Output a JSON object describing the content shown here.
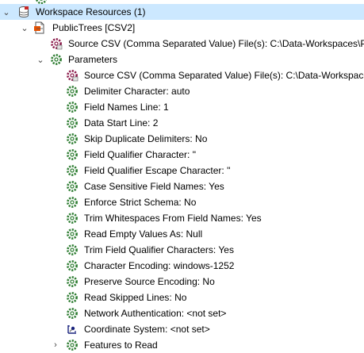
{
  "tree": {
    "root": {
      "label": "Workspace Resources (1)",
      "icon": "database-icon"
    },
    "reader": {
      "label": "PublicTrees [CSV2]",
      "icon": "csv-file-icon"
    },
    "source_dataset": {
      "label": "Source CSV (Comma Separated Value) File(s): C:\\Data-Workspaces\\P...",
      "icon": "dataset-gear-icon"
    },
    "parameters": {
      "label": "Parameters",
      "icon": "gear-icon"
    },
    "params": [
      {
        "label": "Source CSV (Comma Separated Value) File(s): C:\\Data-Workspace...",
        "icon": "dataset-gear-icon"
      },
      {
        "label": "Delimiter Character: auto",
        "icon": "gear-icon"
      },
      {
        "label": "Field Names Line: 1",
        "icon": "gear-icon"
      },
      {
        "label": "Data Start Line: 2",
        "icon": "gear-icon"
      },
      {
        "label": "Skip Duplicate Delimiters: No",
        "icon": "gear-icon"
      },
      {
        "label": "Field Qualifier Character: \"",
        "icon": "gear-icon"
      },
      {
        "label": "Field Qualifier Escape Character: \"",
        "icon": "gear-icon"
      },
      {
        "label": "Case Sensitive Field Names: Yes",
        "icon": "gear-icon"
      },
      {
        "label": "Enforce Strict Schema: No",
        "icon": "gear-icon"
      },
      {
        "label": "Trim Whitespaces From Field Names: Yes",
        "icon": "gear-icon"
      },
      {
        "label": "Read Empty Values As: Null",
        "icon": "gear-icon"
      },
      {
        "label": "Trim Field Qualifier Characters: Yes",
        "icon": "gear-icon"
      },
      {
        "label": "Character Encoding: windows-1252",
        "icon": "gear-icon"
      },
      {
        "label": "Preserve Source Encoding: No",
        "icon": "gear-icon"
      },
      {
        "label": "Read Skipped Lines: No",
        "icon": "gear-icon"
      },
      {
        "label": "Network Authentication: <not set>",
        "icon": "gear-icon"
      },
      {
        "label": "Coordinate System: <not set>",
        "icon": "coordinate-system-icon"
      }
    ],
    "features": {
      "label": "Features to Read",
      "icon": "gear-icon"
    }
  },
  "colors": {
    "selection": "#cce8ff",
    "gear": "#2e7d32",
    "dataset_icon": "#8b1a4a"
  }
}
